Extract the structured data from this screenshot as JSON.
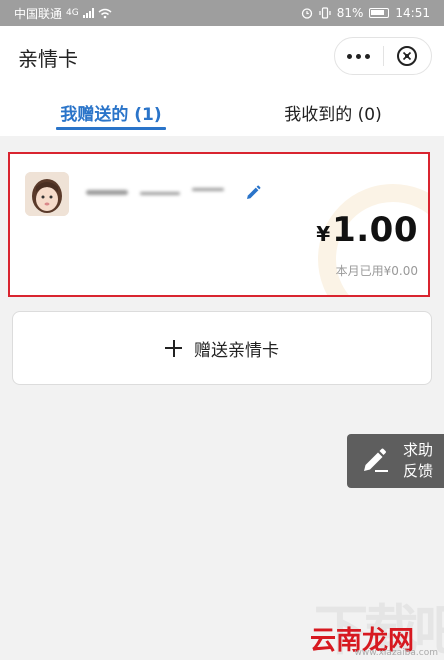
{
  "status_bar": {
    "carrier": "中国联通",
    "network": "4G",
    "battery": "81%",
    "time": "14:51"
  },
  "header": {
    "title": "亲情卡",
    "more_icon": "more-dots-icon",
    "close_icon": "close-circle-icon"
  },
  "tabs": [
    {
      "label": "我赠送的 (1)",
      "active": true
    },
    {
      "label": "我收到的 (0)",
      "active": false
    }
  ],
  "card": {
    "amount_currency": "¥",
    "amount_value": "1.00",
    "used_text": "本月已用¥0.00",
    "edit_icon": "pencil-icon"
  },
  "gift_button": {
    "label": "赠送亲情卡"
  },
  "help": {
    "line1": "求助",
    "line2": "反馈"
  },
  "watermark": {
    "text": "云南龙网",
    "url": "www.xiazaiba.com"
  },
  "colors": {
    "accent": "#2a74c9",
    "highlight_border": "#d9242f"
  }
}
